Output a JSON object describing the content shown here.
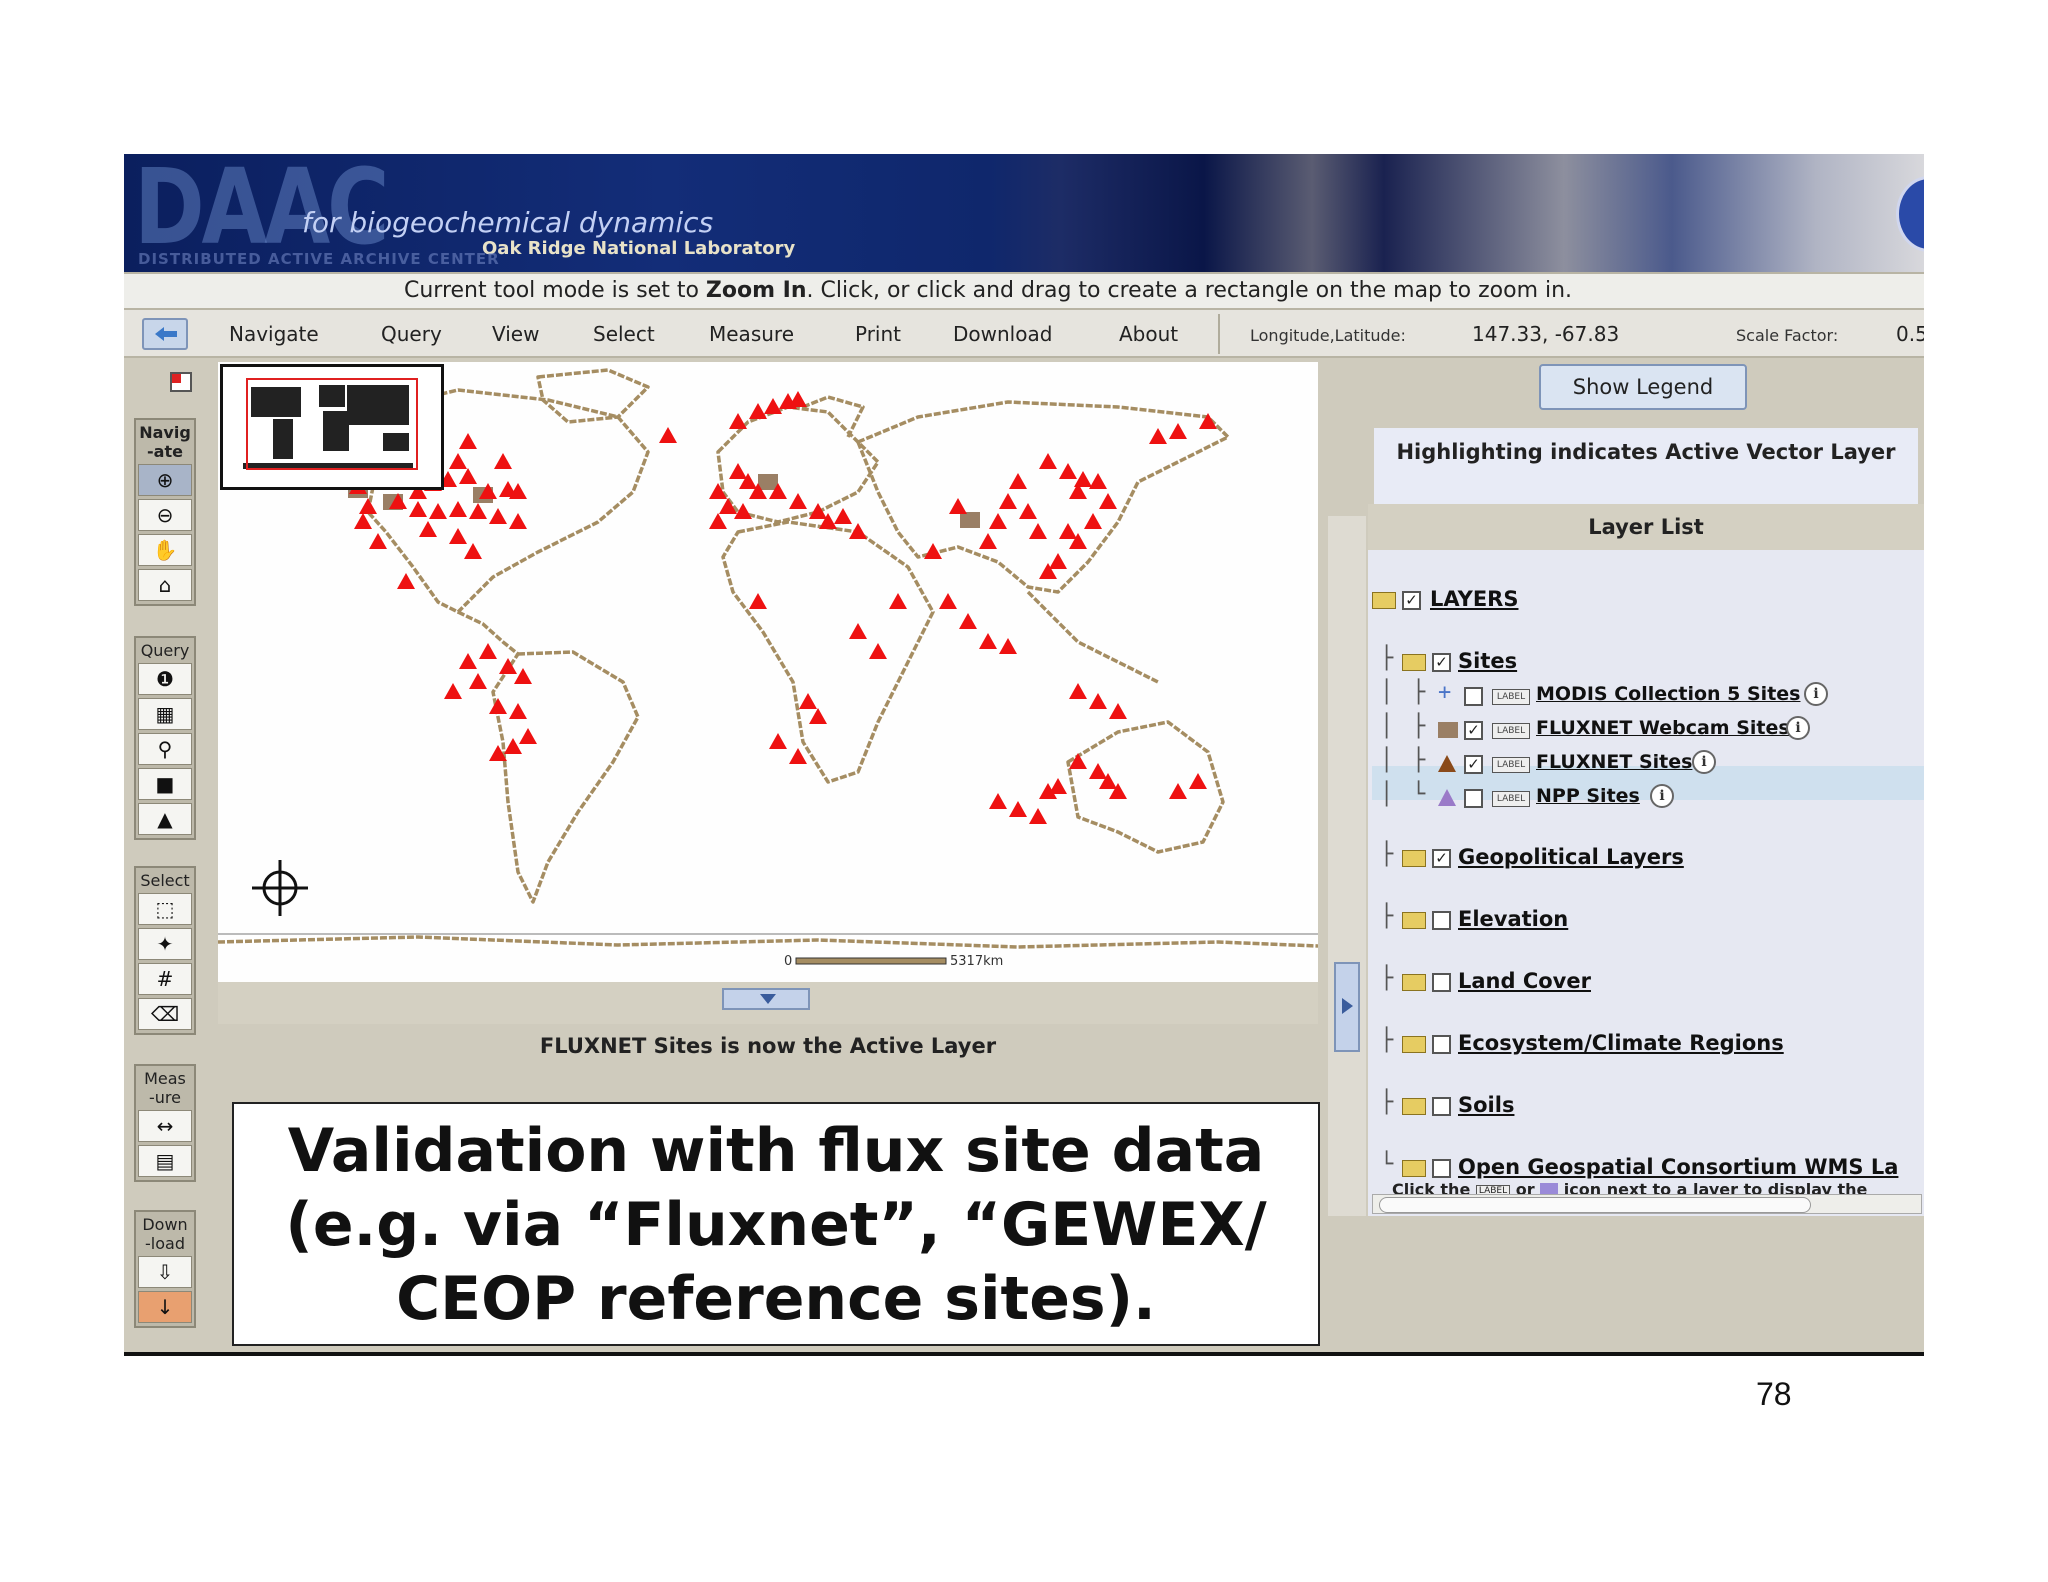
{
  "banner": {
    "logo": "DAAC",
    "tagline": "for biogeochemical dynamics",
    "org": "Oak Ridge National Laboratory",
    "subtitle": "DISTRIBUTED ACTIVE ARCHIVE CENTER"
  },
  "status": {
    "prefix": "Current tool mode is set to ",
    "mode": "Zoom In",
    "suffix": ". Click, or click and drag to create a rectangle on the map to zoom in."
  },
  "menu": {
    "items": [
      "Navigate",
      "Query",
      "View",
      "Select",
      "Measure",
      "Print",
      "Download",
      "About"
    ],
    "coord_label": "Longitude,Latitude:",
    "coord_value": "147.33, -67.83",
    "scale_label": "Scale Factor:",
    "scale_value": "0.5"
  },
  "tools": {
    "groups": [
      {
        "label_a": "Navig",
        "label_b": "-ate"
      },
      {
        "label_a": "Query",
        "label_b": ""
      },
      {
        "label_a": "Select",
        "label_b": ""
      },
      {
        "label_a": "Meas",
        "label_b": "-ure"
      },
      {
        "label_a": "Down",
        "label_b": "-load"
      }
    ]
  },
  "map": {
    "scale_start": "0",
    "scale_end": "5317km",
    "active_layer_msg": "FLUXNET Sites is now the Active Layer",
    "marker_color": "#ee1111"
  },
  "caption": {
    "line1": "Validation with flux site data",
    "line2": "(e.g. via “Fluxnet”, “GEWEX/",
    "line3": "CEOP reference sites)."
  },
  "legend": {
    "show_button": "Show Legend",
    "highlight_note": "Highlighting indicates Active Vector Layer",
    "layer_list_title": "Layer List",
    "label_icon_text": "LABEL",
    "info_icon_text": "i",
    "layers": {
      "root": "LAYERS",
      "sites": "Sites",
      "modis": "MODIS Collection 5 Sites",
      "webcam": "FLUXNET Webcam Sites",
      "fluxnet": "FLUXNET Sites",
      "npp": "NPP Sites",
      "geopolitical": "Geopolitical Layers",
      "elevation": "Elevation",
      "landcover": "Land Cover",
      "ecosystem": "Ecosystem/Climate Regions",
      "soils": "Soils",
      "ogc": "Open Geospatial Consortium WMS La"
    },
    "footer_part1": "Click the",
    "footer_part2": "or",
    "footer_part3": "icon next to a layer to display the"
  },
  "page_number": "78"
}
